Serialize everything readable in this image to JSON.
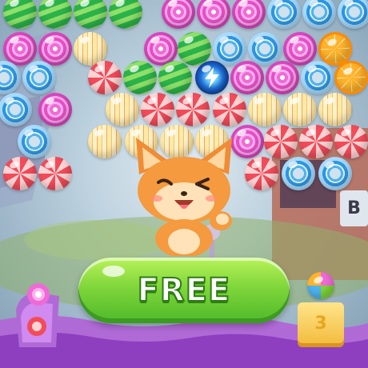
{
  "game": {
    "cta_label": "FREE",
    "level_badge": "3",
    "storefront_sign": "B"
  },
  "palette": {
    "button_green": "#7fd63a",
    "frame_purple": "#b06ad6",
    "background_blue": "#bfd3e0"
  },
  "bubbles": [
    {
      "id": "b1",
      "type": "green"
    },
    {
      "id": "b2",
      "type": "green"
    },
    {
      "id": "b3",
      "type": "green"
    },
    {
      "id": "b4",
      "type": "green"
    },
    {
      "id": "b5",
      "type": "pink"
    },
    {
      "id": "b6",
      "type": "pink"
    },
    {
      "id": "b7",
      "type": "pink"
    },
    {
      "id": "b8",
      "type": "ring"
    },
    {
      "id": "b9",
      "type": "ring"
    },
    {
      "id": "b10",
      "type": "ring"
    },
    {
      "id": "b11",
      "type": "pink"
    },
    {
      "id": "b12",
      "type": "pink"
    },
    {
      "id": "b13",
      "type": "cream"
    },
    {
      "id": "b14",
      "type": "pink"
    },
    {
      "id": "b15",
      "type": "green"
    },
    {
      "id": "b16",
      "type": "ring"
    },
    {
      "id": "b17",
      "type": "ring"
    },
    {
      "id": "b18",
      "type": "pink"
    },
    {
      "id": "b19",
      "type": "orange"
    },
    {
      "id": "b20",
      "type": "ring"
    },
    {
      "id": "b21",
      "type": "ring"
    },
    {
      "id": "b22",
      "type": "red"
    },
    {
      "id": "b23",
      "type": "green"
    },
    {
      "id": "b24",
      "type": "green"
    },
    {
      "id": "b25",
      "type": "lightning"
    },
    {
      "id": "b26",
      "type": "pink"
    },
    {
      "id": "b27",
      "type": "pink"
    },
    {
      "id": "b28",
      "type": "ring"
    },
    {
      "id": "b29",
      "type": "orange"
    },
    {
      "id": "b30",
      "type": "ring"
    },
    {
      "id": "b31",
      "type": "pink"
    },
    {
      "id": "b32",
      "type": "cream"
    },
    {
      "id": "b33",
      "type": "red"
    },
    {
      "id": "b34",
      "type": "red"
    },
    {
      "id": "b35",
      "type": "red"
    },
    {
      "id": "b36",
      "type": "cream"
    },
    {
      "id": "b37",
      "type": "cream"
    },
    {
      "id": "b38",
      "type": "cream"
    },
    {
      "id": "b39",
      "type": "ring"
    },
    {
      "id": "b40",
      "type": "cream"
    },
    {
      "id": "b41",
      "type": "cream"
    },
    {
      "id": "b42",
      "type": "cream"
    },
    {
      "id": "b43",
      "type": "cream"
    },
    {
      "id": "b44",
      "type": "pink"
    },
    {
      "id": "b45",
      "type": "red"
    },
    {
      "id": "b46",
      "type": "red"
    },
    {
      "id": "b47",
      "type": "red"
    },
    {
      "id": "b48",
      "type": "red"
    },
    {
      "id": "b49",
      "type": "red"
    },
    {
      "id": "b50",
      "type": "red"
    },
    {
      "id": "b51",
      "type": "ring"
    },
    {
      "id": "b52",
      "type": "ring"
    }
  ]
}
